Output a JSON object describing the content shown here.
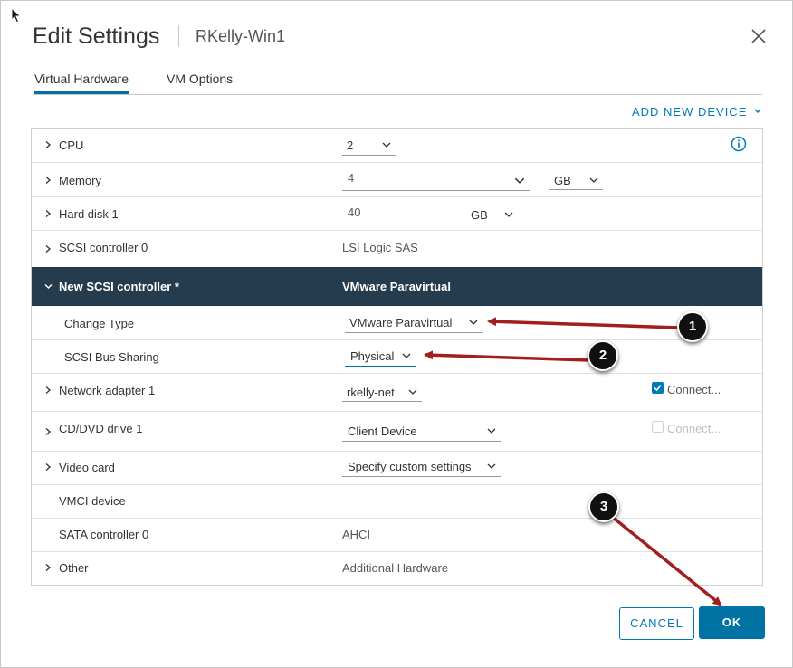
{
  "dialog": {
    "title": "Edit Settings",
    "subtitle": "RKelly-Win1",
    "close_icon": "close-icon"
  },
  "tabs": [
    {
      "label": "Virtual Hardware",
      "active": true
    },
    {
      "label": "VM Options",
      "active": false
    }
  ],
  "add_new_device": "ADD NEW DEVICE",
  "hardware": {
    "cpu": {
      "label": "CPU",
      "value": "2"
    },
    "memory": {
      "label": "Memory",
      "value": "4",
      "unit": "GB"
    },
    "hard_disk": {
      "label": "Hard disk 1",
      "value": "40",
      "unit": "GB"
    },
    "scsi_controller_0": {
      "label": "SCSI controller 0",
      "value": "LSI Logic SAS"
    },
    "new_scsi": {
      "label": "New SCSI controller *",
      "value": "VMware Paravirtual"
    },
    "change_type": {
      "label": "Change Type",
      "value": "VMware Paravirtual"
    },
    "bus_sharing": {
      "label": "SCSI Bus Sharing",
      "value": "Physical"
    },
    "network_adapter": {
      "label": "Network adapter 1",
      "value": "rkelly-net",
      "connect_label": "Connect...",
      "connected": true
    },
    "cd_dvd": {
      "label": "CD/DVD drive 1",
      "value": "Client Device",
      "connect_label": "Connect...",
      "connected": false
    },
    "video_card": {
      "label": "Video card",
      "value": "Specify custom settings"
    },
    "vmci": {
      "label": "VMCI device"
    },
    "sata": {
      "label": "SATA controller 0",
      "value": "AHCI"
    },
    "other": {
      "label": "Other",
      "value": "Additional Hardware"
    }
  },
  "markers": [
    "1",
    "2",
    "3"
  ],
  "buttons": {
    "cancel": "CANCEL",
    "ok": "OK"
  },
  "colors": {
    "accent": "#0072a3",
    "header_row": "#253c4f",
    "annotation_arrow": "#a31e1e"
  }
}
